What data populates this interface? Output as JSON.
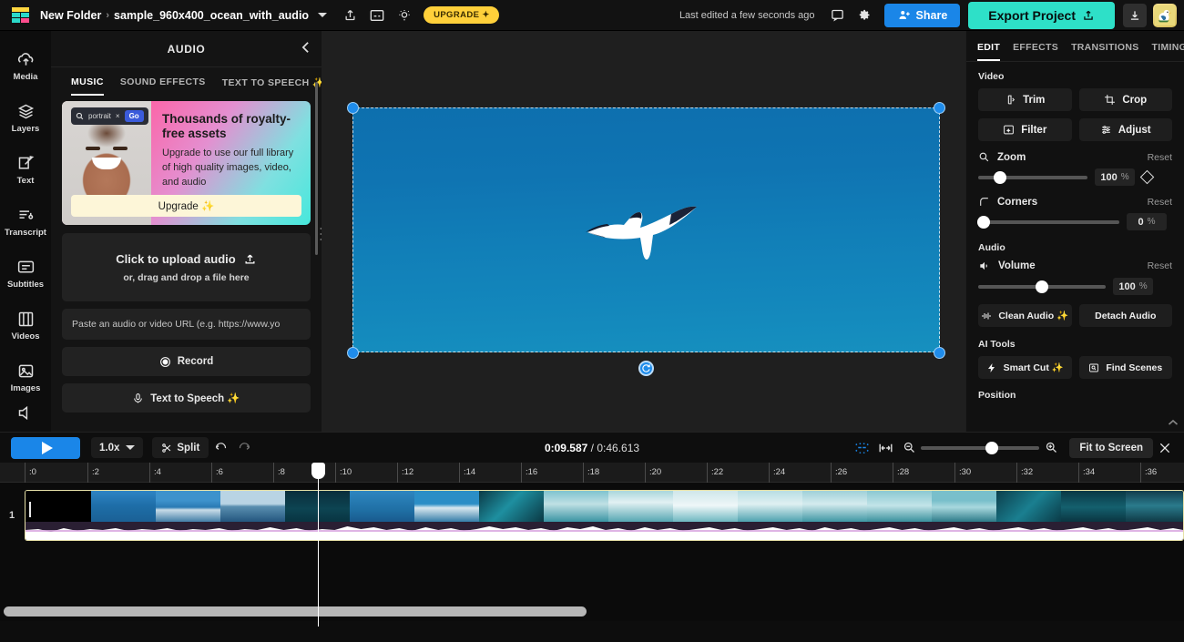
{
  "topbar": {
    "folder": "New Folder",
    "separator": "›",
    "project_name": "sample_960x400_ocean_with_audio",
    "upgrade_label": "UPGRADE",
    "upgrade_sparkle": "✦",
    "last_edited": "Last edited a few seconds ago",
    "share_label": "Share",
    "export_label": "Export Project",
    "icons": {
      "project_dropdown": "chevron-down-icon",
      "share_out": "share-icon",
      "captions": "captions-icon",
      "idea": "lightbulb-icon",
      "comment": "comment-icon",
      "settings": "gear-icon",
      "download": "download-icon",
      "avatar": "avatar-bird"
    }
  },
  "rail": {
    "items": [
      {
        "label": "Media",
        "icon": "upload-cloud-icon"
      },
      {
        "label": "Layers",
        "icon": "layers-icon"
      },
      {
        "label": "Text",
        "icon": "text-edit-icon"
      },
      {
        "label": "Transcript",
        "icon": "transcript-icon"
      },
      {
        "label": "Subtitles",
        "icon": "subtitles-icon"
      },
      {
        "label": "Videos",
        "icon": "film-icon"
      },
      {
        "label": "Images",
        "icon": "image-icon"
      },
      {
        "label": "",
        "icon": "audio-icon"
      }
    ]
  },
  "panel": {
    "title": "AUDIO",
    "collapse_icon": "chevron-left-icon",
    "tabs": [
      {
        "label": "MUSIC",
        "active": true
      },
      {
        "label": "SOUND EFFECTS",
        "active": false
      },
      {
        "label": "TEXT TO SPEECH ✨",
        "active": false
      }
    ],
    "promo": {
      "search_query": "portrait",
      "search_clear": "×",
      "go_label": "Go",
      "heading": "Thousands of royalty-free assets",
      "body": "Upgrade to use our full library of high quality images, video, and audio",
      "cta": "Upgrade ✨"
    },
    "upload": {
      "title": "Click to upload audio",
      "subtitle": "or, drag and drop a file here",
      "icon": "upload-icon"
    },
    "url_placeholder": "Paste an audio or video URL (e.g. https://www.yo",
    "buttons": [
      {
        "label": "Record",
        "icon": "record-icon"
      },
      {
        "label": "Text to Speech ✨",
        "icon": "speech-icon"
      }
    ]
  },
  "preview": {
    "scene_description": "white seabird with black wingtips gliding over blue ocean",
    "rotate_icon": "rotate-icon",
    "drag_dots": "···"
  },
  "inspector": {
    "tabs": [
      {
        "label": "EDIT",
        "active": true
      },
      {
        "label": "EFFECTS",
        "active": false
      },
      {
        "label": "TRANSITIONS",
        "active": false
      },
      {
        "label": "TIMING",
        "active": false
      }
    ],
    "sections": {
      "video": {
        "title": "Video",
        "buttons": [
          {
            "label": "Trim",
            "icon": "trim-icon"
          },
          {
            "label": "Crop",
            "icon": "crop-icon"
          },
          {
            "label": "Filter",
            "icon": "filter-icon"
          },
          {
            "label": "Adjust",
            "icon": "adjust-icon"
          }
        ],
        "zoom": {
          "label": "Zoom",
          "icon": "magnifier-icon",
          "reset": "Reset",
          "value": "100",
          "unit": "%",
          "slider_pct": 20,
          "keyframe_icon": "diamond-keyframe-icon"
        },
        "corners": {
          "label": "Corners",
          "icon": "corner-radius-icon",
          "reset": "Reset",
          "value": "0",
          "unit": "%",
          "slider_pct": 0
        }
      },
      "audio": {
        "title": "Audio",
        "volume": {
          "label": "Volume",
          "icon": "speaker-icon",
          "reset": "Reset",
          "value": "100",
          "unit": "%",
          "slider_pct": 50
        },
        "buttons": [
          {
            "label": "Clean Audio ✨",
            "icon": "waveform-icon"
          },
          {
            "label": "Detach Audio",
            "icon": ""
          }
        ]
      },
      "ai_tools": {
        "title": "AI Tools",
        "buttons": [
          {
            "label": "Smart Cut ✨",
            "icon": "bolt-icon"
          },
          {
            "label": "Find Scenes",
            "icon": "scene-search-icon"
          }
        ]
      },
      "position": {
        "title": "Position"
      }
    }
  },
  "timeline": {
    "play_icon": "play-icon",
    "speed": "1.0x",
    "speed_caret": "chevron-down-icon",
    "split_label": "Split",
    "split_icon": "scissors-icon",
    "undo_icon": "undo-icon",
    "redo_icon": "redo-icon",
    "current_time": "0:09.587",
    "time_separator": " / ",
    "total_time": "0:46.613",
    "snap_icon": "snap-magnet-icon",
    "fit_between_icon": "fit-between-icon",
    "zoom_out_icon": "zoom-out-icon",
    "zoom_in_icon": "zoom-in-icon",
    "zoom_slider_pct": 60,
    "fit_label": "Fit to Screen",
    "close_icon": "close-icon",
    "track_number": "1",
    "ruler_labels": [
      ":0",
      ":2",
      ":4",
      ":6",
      ":8",
      ":10",
      ":12",
      ":14",
      ":16",
      ":18",
      ":20",
      ":22",
      ":24",
      ":26",
      ":28",
      ":30",
      ":32",
      ":34",
      ":36"
    ],
    "playhead_pct": 26.8
  },
  "colors": {
    "accent_blue": "#1a86e8",
    "export_teal": "#2ee0c8",
    "upgrade_yellow": "#ffd03a",
    "clip_outline": "#e5dfa6"
  }
}
